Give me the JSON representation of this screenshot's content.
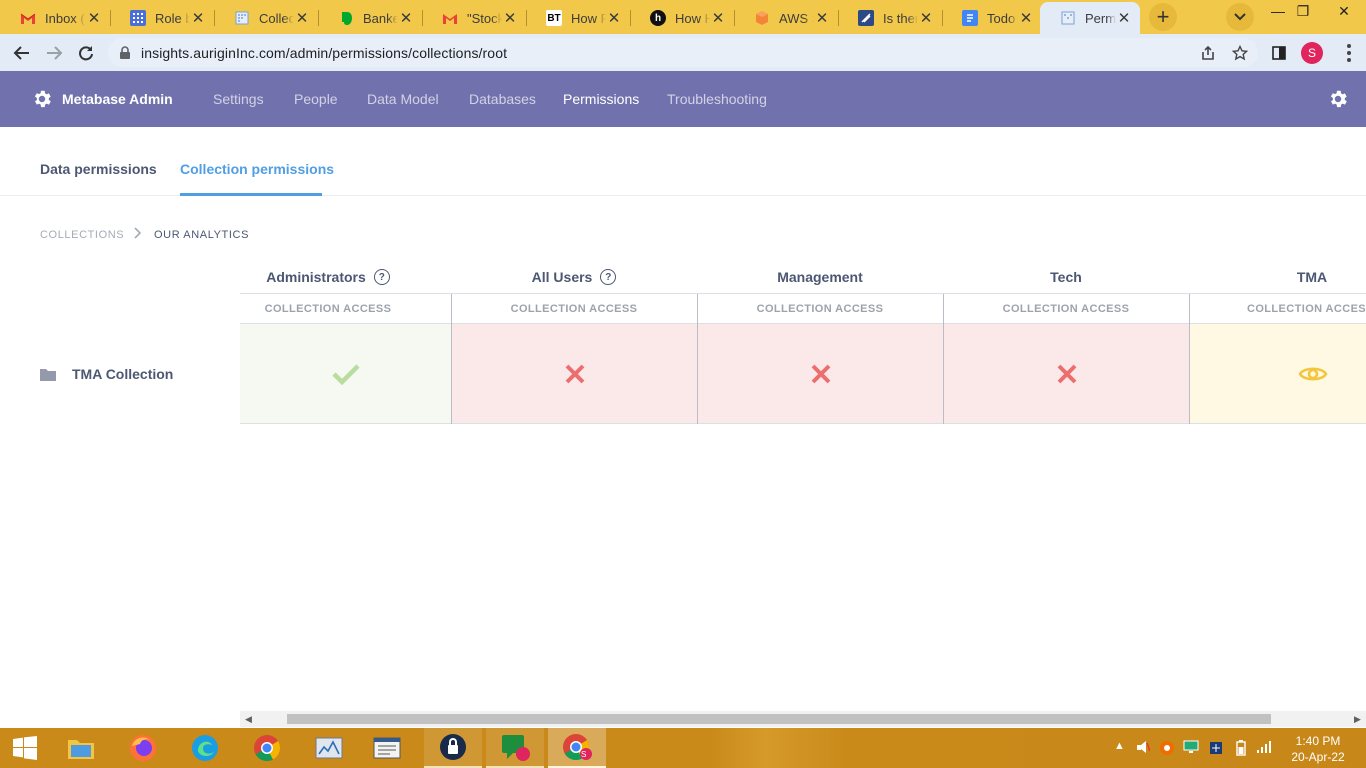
{
  "browser": {
    "tabs": [
      {
        "title": "Inbox (",
        "icon": "gmail-icon"
      },
      {
        "title": "Role ba",
        "icon": "grid-icon"
      },
      {
        "title": "Collecti",
        "icon": "metabase-icon"
      },
      {
        "title": "Banker",
        "icon": "evernote-icon"
      },
      {
        "title": "\"Stocks",
        "icon": "gmail-icon"
      },
      {
        "title": "How Re",
        "icon": "bt-icon"
      },
      {
        "title": "How H",
        "icon": "hashnode-icon"
      },
      {
        "title": "AWS Su",
        "icon": "aws-icon"
      },
      {
        "title": "Is there",
        "icon": "news-icon"
      },
      {
        "title": "Todo -",
        "icon": "docs-icon"
      },
      {
        "title": "Permiss",
        "icon": "metabase-icon"
      }
    ],
    "favicon_labels": {
      "bt": "BT",
      "hashnode": "h"
    },
    "url": "insights.auriginInc.com/admin/permissions/collections/root",
    "profile_initial": "S"
  },
  "admin": {
    "brand": "Metabase Admin",
    "nav": [
      "Settings",
      "People",
      "Data Model",
      "Databases",
      "Permissions",
      "Troubleshooting"
    ],
    "active_nav": "Permissions"
  },
  "subtabs": {
    "data": "Data permissions",
    "collection": "Collection permissions",
    "active": "Collection permissions"
  },
  "breadcrumb": {
    "root": "COLLECTIONS",
    "current": "OUR ANALYTICS"
  },
  "grid": {
    "groups": [
      {
        "name": "Administrators",
        "help": true,
        "sub": "COLLECTION ACCESS",
        "access": "curate"
      },
      {
        "name": "All Users",
        "help": true,
        "sub": "COLLECTION ACCESS",
        "access": "none"
      },
      {
        "name": "Management",
        "help": false,
        "sub": "COLLECTION ACCESS",
        "access": "none"
      },
      {
        "name": "Tech",
        "help": false,
        "sub": "COLLECTION ACCESS",
        "access": "none"
      },
      {
        "name": "TMA",
        "help": false,
        "sub": "COLLECTION ACCESS",
        "access": "view"
      }
    ],
    "row_label": "TMA Collection",
    "help_glyph": "?"
  },
  "taskbar": {
    "time": "1:40 PM",
    "date": "20-Apr-22",
    "badge_initial": "S"
  },
  "colors": {
    "admin_bg": "#7172ad",
    "brand_blue": "#509ee3",
    "curate_bg": "#f6f9f2",
    "curate_icon": "#b9dc9f",
    "none_bg": "#fbe9ea",
    "none_icon": "#ed6e6e",
    "view_bg": "#fff8e3",
    "view_icon": "#f2c63d"
  }
}
